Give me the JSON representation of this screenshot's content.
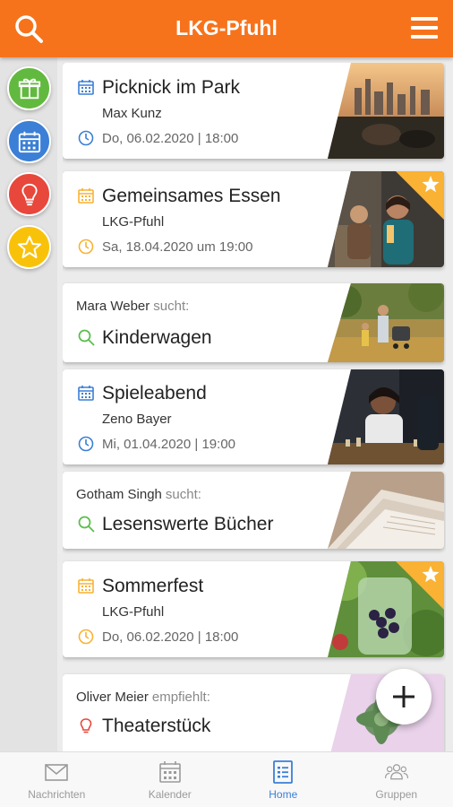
{
  "header": {
    "title": "LKG-Pfuhl"
  },
  "feed": [
    {
      "kind": "event",
      "title": "Picknick im Park",
      "sub": "Max Kunz",
      "date": "Do, 06.02.2020 | 18:00",
      "accent": "#3b7fd6"
    },
    {
      "kind": "event",
      "title": "Gemeinsames Essen",
      "sub": "LKG-Pfuhl",
      "date": "Sa, 18.04.2020 um 19:00",
      "accent": "#f9b233",
      "starred": true
    },
    {
      "kind": "search",
      "who": "Mara Weber",
      "verb": "sucht:",
      "title": "Kinderwagen",
      "accent": "#5bbf4e"
    },
    {
      "kind": "event",
      "title": "Spieleabend",
      "sub": "Zeno Bayer",
      "date": "Mi, 01.04.2020 | 19:00",
      "accent": "#3b7fd6"
    },
    {
      "kind": "search",
      "who": "Gotham Singh",
      "verb": "sucht:",
      "title": "Lesenswerte Bücher",
      "accent": "#5bbf4e"
    },
    {
      "kind": "event",
      "title": "Sommerfest",
      "sub": "LKG-Pfuhl",
      "date": "Do, 06.02.2020 | 18:00",
      "accent": "#f9b233",
      "starred": true
    },
    {
      "kind": "recommend",
      "who": "Oliver Meier",
      "verb": "empfiehlt:",
      "title": "Theaterstück",
      "accent": "#e8473b"
    }
  ],
  "nav": [
    {
      "label": "Nachrichten",
      "icon": "envelope-icon"
    },
    {
      "label": "Kalender",
      "icon": "calendar-icon"
    },
    {
      "label": "Home",
      "icon": "list-icon",
      "active": true
    },
    {
      "label": "Gruppen",
      "icon": "group-icon"
    }
  ],
  "colors": {
    "brand": "#f7731b",
    "blue": "#3b7fd6",
    "green": "#5bbf4e",
    "red": "#e8473b",
    "yellow": "#f9b233"
  }
}
